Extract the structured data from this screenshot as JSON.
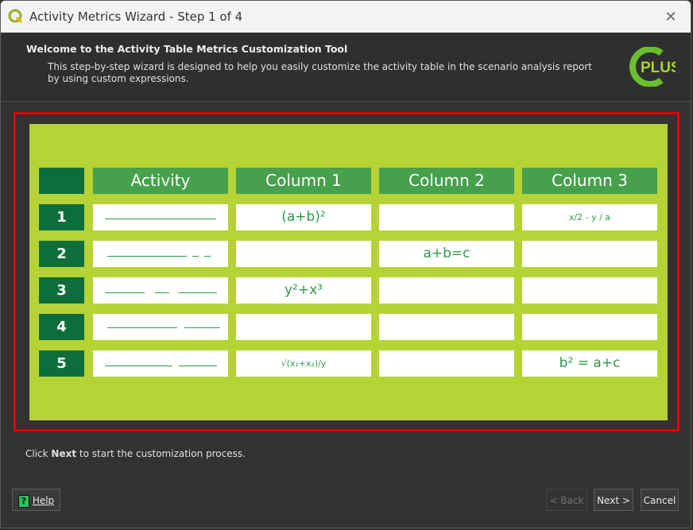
{
  "window": {
    "title": "Activity Metrics Wizard - Step 1 of 4",
    "close_glyph": "✕"
  },
  "header": {
    "title": "Welcome to the Activity Table Metrics Customization Tool",
    "description": "This step-by-step wizard is designed to help you easily customize the activity table in the scenario analysis report by using custom expressions.",
    "logo_text": "PLUS"
  },
  "illustration": {
    "columns": [
      "Activity",
      "Column 1",
      "Column 2",
      "Column 3"
    ],
    "rows": [
      {
        "num": "1",
        "col1": "(a+b)²",
        "col2": "",
        "col3": "x/2 - y / a"
      },
      {
        "num": "2",
        "col1": "",
        "col2": "a+b=c",
        "col3": ""
      },
      {
        "num": "3",
        "col1": "y²+x³",
        "col2": "",
        "col3": ""
      },
      {
        "num": "4",
        "col1": "",
        "col2": "",
        "col3": ""
      },
      {
        "num": "5",
        "col1": "√(x₁+x₂)/y",
        "col2": "",
        "col3": "b² = a+c"
      }
    ]
  },
  "footer": {
    "prefix": "Click ",
    "bold": "Next",
    "suffix": " to start the customization process."
  },
  "buttons": {
    "help": "Help",
    "back": "< Back",
    "next": "Next >",
    "cancel": "Cancel"
  },
  "colors": {
    "accent_frame": "#e00000",
    "illustration_bg": "#b5d334",
    "header_green": "#46a04c",
    "row_green": "#0d6e3b"
  }
}
